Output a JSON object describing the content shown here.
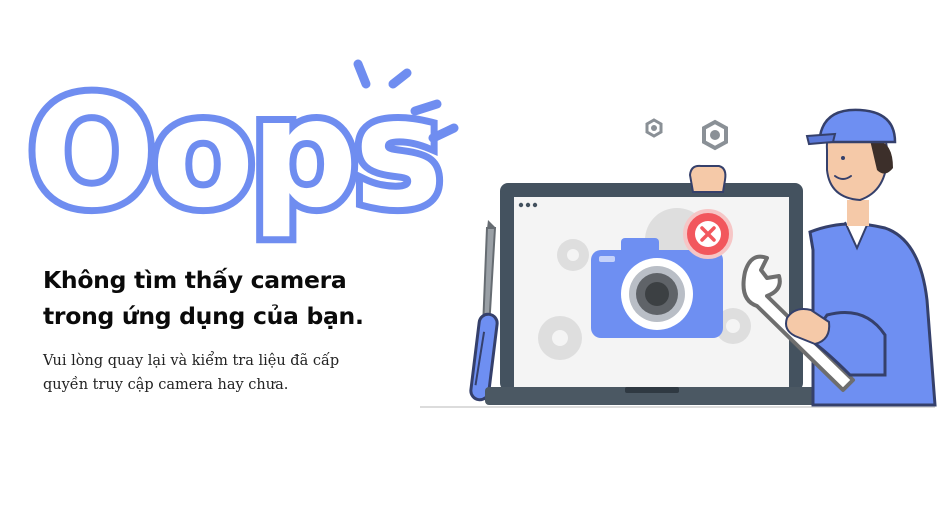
{
  "hero": {
    "title": "Oops",
    "heading_line1": "Không tìm thấy camera",
    "heading_line2": "trong ứng dụng của bạn.",
    "description_line1": "Vui lòng quay lại và kiểm tra liệu đã cấp",
    "description_line2": "quyền truy cập camera hay chưa."
  },
  "colors": {
    "accent": "#6f8df0",
    "error_badge": "#f2575d",
    "laptop_frame": "#44525f",
    "uniform": "#6e8ff2"
  },
  "icons": [
    "camera-icon",
    "error-x-icon",
    "gear-icon",
    "wrench-icon",
    "screwdriver-icon",
    "nut-icon"
  ]
}
